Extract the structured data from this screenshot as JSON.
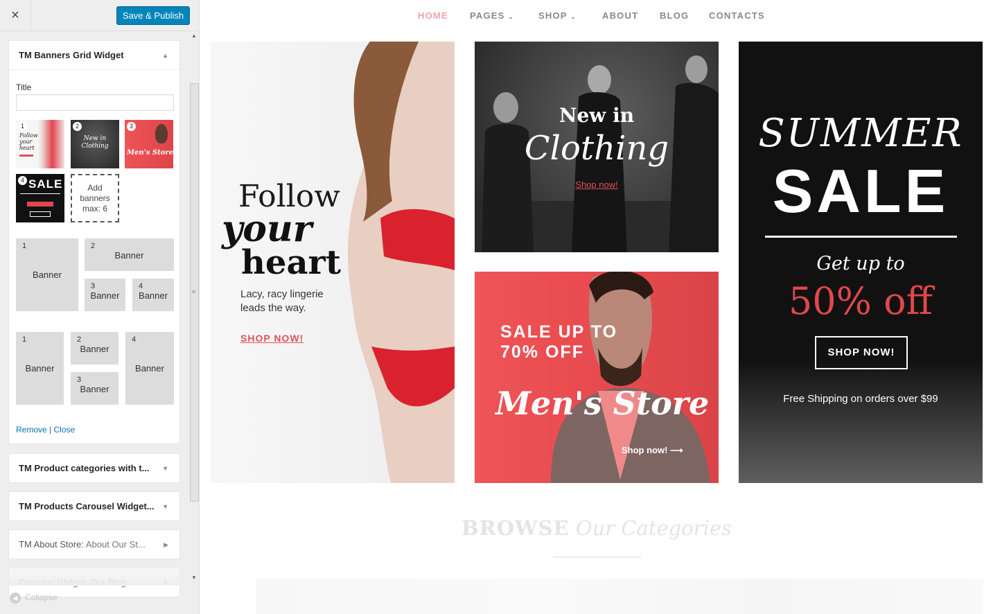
{
  "customizer": {
    "close_icon": "×",
    "save_label": "Save & Publish",
    "widget_main": {
      "title": "TM Banners Grid Widget",
      "title_field_label": "Title",
      "title_field_value": "",
      "thumbnails": [
        {
          "num": "1",
          "text": "Follow your heart"
        },
        {
          "num": "2",
          "text": "New in Clothing"
        },
        {
          "num": "3",
          "text": "Men's Store"
        },
        {
          "num": "4",
          "text": "SALE"
        }
      ],
      "add_banners": "Add banners max: 6",
      "layout_a": [
        {
          "num": "1",
          "label": "Banner"
        },
        {
          "num": "2",
          "label": "Banner"
        },
        {
          "num": "3",
          "label": "Banner"
        },
        {
          "num": "4",
          "label": "Banner"
        }
      ],
      "layout_b": [
        {
          "num": "1",
          "label": "Banner"
        },
        {
          "num": "2",
          "label": "Banner"
        },
        {
          "num": "3",
          "label": "Banner"
        },
        {
          "num": "4",
          "label": "Banner"
        }
      ],
      "remove_label": "Remove",
      "separator": "|",
      "close_label": "Close"
    },
    "other_widgets": [
      {
        "title": "TM Product categories with t...",
        "sub": ""
      },
      {
        "title": "TM Products Carousel Widget...",
        "sub": ""
      },
      {
        "title": "TM About Store:",
        "sub": "About Our St..."
      },
      {
        "title": "Carousel Widget:",
        "sub": "Our Blog"
      }
    ],
    "collapse_label": "Collapse"
  },
  "site": {
    "nav": [
      {
        "label": "HOME",
        "active": true
      },
      {
        "label": "PAGES",
        "dropdown": true
      },
      {
        "label": "SHOP",
        "dropdown": true
      },
      {
        "label": "ABOUT"
      },
      {
        "label": "BLOG"
      },
      {
        "label": "CONTACTS"
      }
    ],
    "banner1": {
      "line1": "Follow",
      "line2": "your",
      "line3": "heart",
      "copy": "Lacy, racy lingerie leads the way.",
      "cta": "SHOP NOW!"
    },
    "banner2": {
      "line1": "New in",
      "line2": "Clothing",
      "cta": "Shop now!"
    },
    "banner3": {
      "sale": "SALE UP TO 70% OFF",
      "store": "Men's Store",
      "cta": "Shop now! ⟶"
    },
    "banner4": {
      "summer": "SUMMER",
      "sale": "SALE",
      "getup": "Get up to",
      "off": "50% off",
      "button": "SHOP NOW!",
      "shipping": "Free Shipping on orders over $99"
    },
    "browse": {
      "bold": "BROWSE",
      "italic": "Our Categories"
    }
  },
  "colors": {
    "accent_blue": "#0085ba",
    "accent_red": "#e0515c",
    "nav_active": "#f5a0a6"
  }
}
